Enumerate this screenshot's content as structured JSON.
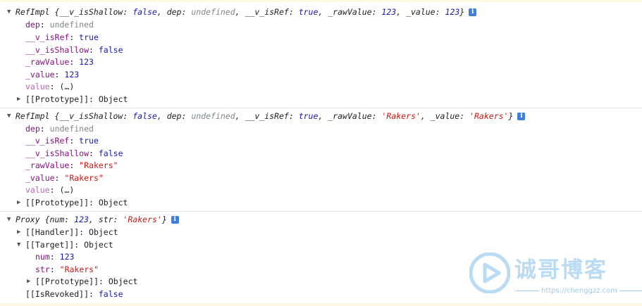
{
  "entries": [
    {
      "summary_class": "RefImpl",
      "summary": [
        {
          "k": "__v_isShallow",
          "v": "false",
          "t": "b"
        },
        {
          "k": "dep",
          "v": "undefined",
          "t": "u"
        },
        {
          "k": "__v_isRef",
          "v": "true",
          "t": "b"
        },
        {
          "k": "_rawValue",
          "v": "123",
          "t": "b"
        },
        {
          "k": "_value",
          "v": "123",
          "t": "b"
        }
      ],
      "props": {
        "dep": "undefined",
        "isRef": "true",
        "isShallow": "false",
        "rawValue": "123",
        "value": "123",
        "getter": "(…)",
        "prototype": "Object"
      }
    },
    {
      "summary_class": "RefImpl",
      "summary": [
        {
          "k": "__v_isShallow",
          "v": "false",
          "t": "b"
        },
        {
          "k": "dep",
          "v": "undefined",
          "t": "u"
        },
        {
          "k": "__v_isRef",
          "v": "true",
          "t": "b"
        },
        {
          "k": "_rawValue",
          "v": "'Rakers'",
          "t": "s"
        },
        {
          "k": "_value",
          "v": "'Rakers'",
          "t": "s"
        }
      ],
      "props": {
        "dep": "undefined",
        "isRef": "true",
        "isShallow": "false",
        "rawValue": "\"Rakers\"",
        "value": "\"Rakers\"",
        "getter": "(…)",
        "prototype": "Object"
      }
    },
    {
      "summary_class": "Proxy",
      "summary": [
        {
          "k": "num",
          "v": "123",
          "t": "b"
        },
        {
          "k": "str",
          "v": "'Rakers'",
          "t": "s"
        }
      ],
      "handler": "Object",
      "target": "Object",
      "target_props": {
        "num": "123",
        "str": "\"Rakers\"",
        "prototype": "Object"
      },
      "isRevoked": "false"
    }
  ],
  "labels": {
    "dep": "dep",
    "isRef": "__v_isRef",
    "isShallow": "__v_isShallow",
    "rawValue": "_rawValue",
    "value_field": "_value",
    "value_getter": "value",
    "prototype": "[[Prototype]]",
    "handler": "[[Handler]]",
    "target": "[[Target]]",
    "num": "num",
    "str": "str",
    "isRevoked": "[[IsRevoked]]"
  },
  "icons": {
    "expanded": "triangle-down-icon",
    "collapsed": "triangle-right-icon",
    "info": "info-icon"
  },
  "watermark": {
    "title": "诚哥博客",
    "url": "https://chenggzz.com",
    "color": "#b9dbf3"
  }
}
